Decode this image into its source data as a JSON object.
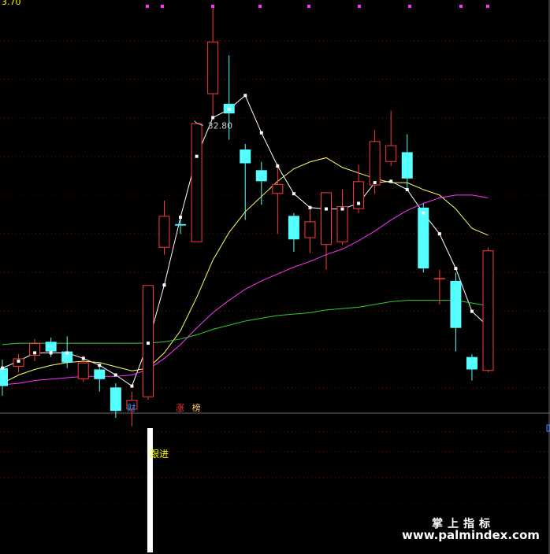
{
  "colors": {
    "up": "#ff3b3b",
    "down": "#55ffff",
    "ma_white": "#ffffff",
    "ma_yellow": "#ffff66",
    "ma_magenta": "#ff33ff",
    "ma_green": "#33cc33",
    "grid": "#8b0000",
    "divider": "#6a6a6a",
    "marker": "#ff33ff",
    "signal_bar": "#ffffff",
    "signal_text": "#ffff00",
    "badge_cai": "#3399ff",
    "badge_zhang": "#ff3333",
    "badge_bang": "#ffcc66"
  },
  "top_left_value": "3.70",
  "watermark": {
    "title": "掌上指标",
    "url": "www.palmindex.com"
  },
  "chart_data": {
    "type": "candlestick",
    "ylim": [
      4.7,
      34.5
    ],
    "grid": true,
    "annotations": [
      {
        "text": "32.80",
        "index": 12
      }
    ],
    "badges": [
      {
        "text": "财",
        "index": 8
      },
      {
        "text": "涨",
        "index": 11
      },
      {
        "text": "榜",
        "index": 12
      }
    ],
    "x": [
      0,
      1,
      2,
      3,
      4,
      5,
      6,
      7,
      8,
      9,
      10,
      11,
      12,
      13,
      14,
      15,
      16,
      17,
      18,
      19,
      20,
      21,
      22,
      23,
      24,
      25,
      26,
      27,
      28,
      29,
      30
    ],
    "candles": [
      {
        "open": 7.9,
        "close": 6.6,
        "high": 8.5,
        "low": 5.9
      },
      {
        "open": 8.0,
        "close": 8.6,
        "high": 8.9,
        "low": 7.6
      },
      {
        "open": 8.8,
        "close": 9.7,
        "high": 10.0,
        "low": 8.4
      },
      {
        "open": 9.8,
        "close": 9.1,
        "high": 10.1,
        "low": 8.7
      },
      {
        "open": 9.1,
        "close": 8.3,
        "high": 10.2,
        "low": 7.9
      },
      {
        "open": 7.1,
        "close": 8.3,
        "high": 8.8,
        "low": 6.9
      },
      {
        "open": 7.8,
        "close": 7.1,
        "high": 8.1,
        "low": 6.2
      },
      {
        "open": 6.5,
        "close": 4.8,
        "high": 6.8,
        "low": 4.3
      },
      {
        "open": 4.9,
        "close": 5.6,
        "high": 6.2,
        "low": 3.7
      },
      {
        "open": 5.8,
        "close": 13.9,
        "high": 13.9,
        "low": 5.6
      },
      {
        "open": 16.6,
        "close": 18.9,
        "high": 20.0,
        "low": 16.1
      },
      {
        "open": 18.3,
        "close": 18.2,
        "high": 18.7,
        "low": 17.6
      },
      {
        "open": 17.0,
        "close": 25.6,
        "high": 25.6,
        "low": 17.0
      },
      {
        "open": 27.7,
        "close": 31.5,
        "high": 34.0,
        "low": 26.0
      },
      {
        "open": 27.0,
        "close": 26.3,
        "high": 30.5,
        "low": 24.4
      },
      {
        "open": 23.7,
        "close": 22.7,
        "high": 24.1,
        "low": 18.6
      },
      {
        "open": 22.2,
        "close": 21.4,
        "high": 22.8,
        "low": 19.7
      },
      {
        "open": 20.5,
        "close": 21.2,
        "high": 22.7,
        "low": 17.6
      },
      {
        "open": 18.9,
        "close": 17.2,
        "high": 19.1,
        "low": 16.3
      },
      {
        "open": 17.3,
        "close": 18.5,
        "high": 19.4,
        "low": 16.2
      },
      {
        "open": 16.8,
        "close": 20.6,
        "high": 20.6,
        "low": 15.0
      },
      {
        "open": 17.0,
        "close": 19.6,
        "high": 20.8,
        "low": 16.8
      },
      {
        "open": 19.4,
        "close": 21.4,
        "high": 22.6,
        "low": 19.1
      },
      {
        "open": 21.1,
        "close": 24.3,
        "high": 25.1,
        "low": 20.5
      },
      {
        "open": 22.8,
        "close": 24.0,
        "high": 26.5,
        "low": 22.5
      },
      {
        "open": 23.5,
        "close": 21.6,
        "high": 24.8,
        "low": 20.9
      },
      {
        "open": 19.5,
        "close": 15.1,
        "high": 19.8,
        "low": 14.8
      },
      {
        "open": 14.4,
        "close": 14.4,
        "high": 15.0,
        "low": 12.5
      },
      {
        "open": 14.2,
        "close": 10.8,
        "high": 14.8,
        "low": 9.1
      },
      {
        "open": 8.7,
        "close": 7.8,
        "high": 8.9,
        "low": 7.0
      },
      {
        "open": 7.7,
        "close": 16.4,
        "high": 16.6,
        "low": 7.6
      }
    ],
    "series": [
      {
        "values": [
          7.9,
          8.4,
          9.0,
          9.0,
          9.0,
          8.6,
          8.1,
          7.4,
          6.6,
          9.7,
          13.9,
          18.8,
          23.2,
          26.0,
          26.6,
          27.6,
          24.9,
          22.5,
          20.5,
          19.5,
          19.4,
          19.4,
          19.8,
          21.3,
          21.4,
          20.8,
          19.1,
          17.6,
          15.1,
          12.0,
          10.9
        ]
      },
      {
        "values": [
          6.8,
          7.4,
          7.8,
          8.1,
          8.3,
          8.4,
          8.3,
          8.0,
          7.7,
          7.9,
          9.0,
          10.6,
          13.0,
          15.7,
          17.7,
          19.2,
          20.3,
          21.4,
          22.3,
          22.8,
          23.1,
          22.4,
          22.0,
          21.6,
          21.3,
          21.3,
          20.8,
          20.4,
          19.4,
          18.0,
          17.5
        ]
      },
      {
        "values": [
          6.7,
          6.8,
          7.0,
          7.1,
          7.2,
          7.3,
          7.3,
          7.3,
          7.4,
          7.8,
          8.6,
          9.6,
          10.8,
          11.9,
          12.8,
          13.6,
          14.2,
          14.7,
          15.2,
          15.6,
          16.1,
          16.5,
          17.1,
          17.8,
          18.6,
          19.3,
          19.8,
          20.2,
          20.4,
          20.4,
          20.2
        ]
      },
      {
        "values": [
          9.6,
          9.7,
          9.7,
          9.7,
          9.7,
          9.7,
          9.7,
          9.7,
          9.7,
          9.7,
          9.8,
          10.0,
          10.3,
          10.7,
          11.0,
          11.3,
          11.5,
          11.7,
          11.8,
          11.9,
          12.1,
          12.2,
          12.3,
          12.5,
          12.7,
          12.8,
          12.8,
          12.8,
          12.8,
          12.6,
          12.4
        ]
      }
    ],
    "indicator": {
      "label": "跟进",
      "bar_index": 9,
      "value": 1
    }
  }
}
